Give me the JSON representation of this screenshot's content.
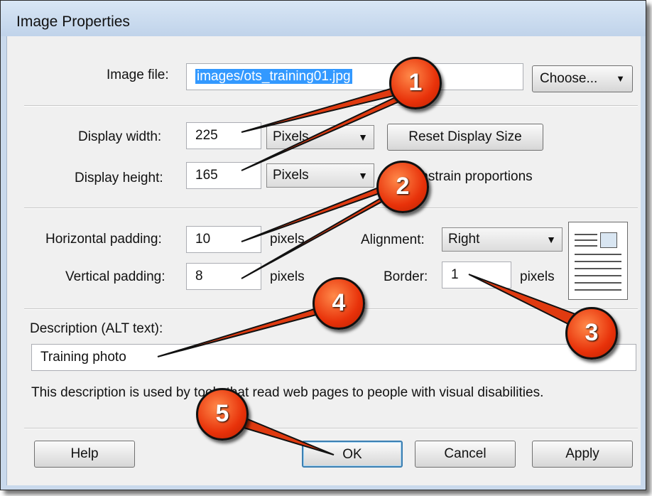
{
  "dialog": {
    "title": "Image Properties"
  },
  "image_file": {
    "label": "Image file:",
    "value": "images/ots_training01.jpg",
    "choose_label": "Choose...",
    "choose_icon": "triangle-down"
  },
  "display": {
    "width_label": "Display width:",
    "width_value": "225",
    "width_unit": "Pixels",
    "height_label": "Display height:",
    "height_value": "165",
    "height_unit": "Pixels",
    "reset_label": "Reset Display Size",
    "constrain_label": "Constrain proportions"
  },
  "padding": {
    "horizontal_label": "Horizontal padding:",
    "horizontal_value": "10",
    "horizontal_unit": "pixels",
    "vertical_label": "Vertical padding:",
    "vertical_value": "8",
    "vertical_unit": "pixels"
  },
  "alignment": {
    "label": "Alignment:",
    "value": "Right"
  },
  "border": {
    "label": "Border:",
    "value": "1",
    "unit": "pixels"
  },
  "description": {
    "label": "Description (ALT text):",
    "value": "Training photo",
    "help_text": "This description is used by tools that read web pages to people with visual disabilities."
  },
  "buttons": {
    "help": "Help",
    "ok": "OK",
    "cancel": "Cancel",
    "apply": "Apply"
  },
  "callouts": [
    "1",
    "2",
    "3",
    "4",
    "5"
  ],
  "colors": {
    "callout": "#e8320a",
    "selection": "#3399ff",
    "default_button_border": "#3c7fb1"
  }
}
